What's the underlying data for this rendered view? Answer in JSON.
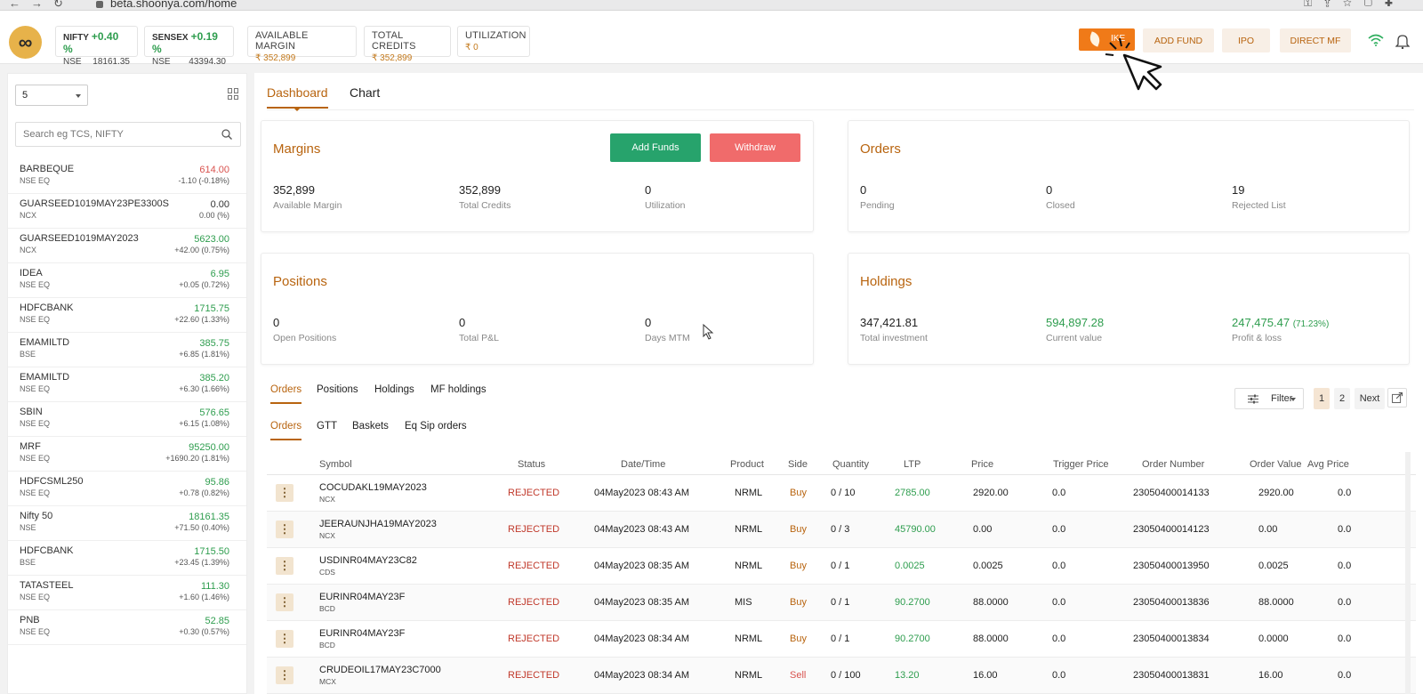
{
  "browser": {
    "url": "beta.shoonya.com/home"
  },
  "header": {
    "indices": [
      {
        "name": "NIFTY",
        "change": "+0.40 %",
        "exchange": "NSE",
        "value": "18161.35"
      },
      {
        "name": "SENSEX",
        "change": "+0.19 %",
        "exchange": "NSE",
        "value": "43394.30"
      }
    ],
    "stats": [
      {
        "label": "AVAILABLE MARGIN",
        "value": "₹ 352,899"
      },
      {
        "label": "TOTAL CREDITS",
        "value": "₹ 352,899"
      },
      {
        "label": "UTILIZATION",
        "value": "₹ 0"
      }
    ],
    "buttons": {
      "ike": "IKE",
      "add_fund": "ADD FUND",
      "ipo": "IPO",
      "direct_mf": "DIRECT MF"
    },
    "logo_glyph": "∞"
  },
  "watchlist": {
    "selected": "5",
    "search_placeholder": "Search eg TCS, NIFTY",
    "items": [
      {
        "symbol": "BARBEQUE",
        "exchange": "NSE EQ",
        "ltp": "614.00",
        "change": "-1.10 (-0.18%)",
        "dir": "down"
      },
      {
        "symbol": "GUARSEED1019MAY23PE3300S",
        "exchange": "NCX",
        "ltp": "0.00",
        "change": "0.00 (%)",
        "dir": "flat"
      },
      {
        "symbol": "GUARSEED1019MAY2023",
        "exchange": "NCX",
        "ltp": "5623.00",
        "change": "+42.00 (0.75%)",
        "dir": "up"
      },
      {
        "symbol": "IDEA",
        "exchange": "NSE EQ",
        "ltp": "6.95",
        "change": "+0.05 (0.72%)",
        "dir": "up"
      },
      {
        "symbol": "HDFCBANK",
        "exchange": "NSE EQ",
        "ltp": "1715.75",
        "change": "+22.60 (1.33%)",
        "dir": "up"
      },
      {
        "symbol": "EMAMILTD",
        "exchange": "BSE",
        "ltp": "385.75",
        "change": "+6.85 (1.81%)",
        "dir": "up"
      },
      {
        "symbol": "EMAMILTD",
        "exchange": "NSE EQ",
        "ltp": "385.20",
        "change": "+6.30 (1.66%)",
        "dir": "up"
      },
      {
        "symbol": "SBIN",
        "exchange": "NSE EQ",
        "ltp": "576.65",
        "change": "+6.15 (1.08%)",
        "dir": "up"
      },
      {
        "symbol": "MRF",
        "exchange": "NSE EQ",
        "ltp": "95250.00",
        "change": "+1690.20 (1.81%)",
        "dir": "up"
      },
      {
        "symbol": "HDFCSML250",
        "exchange": "NSE EQ",
        "ltp": "95.86",
        "change": "+0.78 (0.82%)",
        "dir": "up"
      },
      {
        "symbol": "Nifty 50",
        "exchange": "NSE",
        "ltp": "18161.35",
        "change": "+71.50 (0.40%)",
        "dir": "up"
      },
      {
        "symbol": "HDFCBANK",
        "exchange": "BSE",
        "ltp": "1715.50",
        "change": "+23.45 (1.39%)",
        "dir": "up"
      },
      {
        "symbol": "TATASTEEL",
        "exchange": "NSE EQ",
        "ltp": "111.30",
        "change": "+1.60 (1.46%)",
        "dir": "up"
      },
      {
        "symbol": "PNB",
        "exchange": "NSE EQ",
        "ltp": "52.85",
        "change": "+0.30 (0.57%)",
        "dir": "up"
      }
    ]
  },
  "main": {
    "tabs": [
      "Dashboard",
      "Chart"
    ],
    "margins": {
      "title": "Margins",
      "add_funds": "Add Funds",
      "withdraw": "Withdraw",
      "metrics": [
        {
          "value": "352,899",
          "label": "Available Margin"
        },
        {
          "value": "352,899",
          "label": "Total Credits"
        },
        {
          "value": "0",
          "label": "Utilization"
        }
      ]
    },
    "orders": {
      "title": "Orders",
      "metrics": [
        {
          "value": "0",
          "label": "Pending"
        },
        {
          "value": "0",
          "label": "Closed"
        },
        {
          "value": "19",
          "label": "Rejected List"
        }
      ]
    },
    "positions": {
      "title": "Positions",
      "metrics": [
        {
          "value": "0",
          "label": "Open Positions"
        },
        {
          "value": "0",
          "label": "Total P&L"
        },
        {
          "value": "0",
          "label": "Days MTM"
        }
      ]
    },
    "holdings": {
      "title": "Holdings",
      "metrics": [
        {
          "value": "347,421.81",
          "label": "Total investment"
        },
        {
          "value": "594,897.28",
          "label": "Current value"
        },
        {
          "value": "247,475.47",
          "pct": "(71.23%)",
          "label": "Profit & loss"
        }
      ]
    },
    "bottom_tabs": [
      "Orders",
      "Positions",
      "Holdings",
      "MF holdings"
    ],
    "order_tabs": [
      "Orders",
      "GTT",
      "Baskets",
      "Eq Sip orders"
    ],
    "filter_label": "Filter",
    "pagination": [
      "1",
      "2",
      "Next"
    ],
    "table": {
      "columns": [
        "Symbol",
        "Status",
        "Date/Time",
        "Product",
        "Side",
        "Quantity",
        "LTP",
        "Price",
        "Trigger Price",
        "Order Number",
        "Order Value",
        "Avg Price"
      ],
      "rows": [
        {
          "symbol": "COCUDAKL19MAY2023",
          "exch": "NCX",
          "status": "REJECTED",
          "datetime": "04May2023 08:43 AM",
          "product": "NRML",
          "side": "Buy",
          "qty": "0 / 10",
          "ltp": "2785.00",
          "price": "2920.00",
          "trigger": "0.0",
          "order_no": "23050400014133",
          "order_value": "2920.00",
          "avg": "0.0"
        },
        {
          "symbol": "JEERAUNJHA19MAY2023",
          "exch": "NCX",
          "status": "REJECTED",
          "datetime": "04May2023 08:43 AM",
          "product": "NRML",
          "side": "Buy",
          "qty": "0 / 3",
          "ltp": "45790.00",
          "price": "0.00",
          "trigger": "0.0",
          "order_no": "23050400014123",
          "order_value": "0.00",
          "avg": "0.0"
        },
        {
          "symbol": "USDINR04MAY23C82",
          "exch": "CDS",
          "status": "REJECTED",
          "datetime": "04May2023 08:35 AM",
          "product": "NRML",
          "side": "Buy",
          "qty": "0 / 1",
          "ltp": "0.0025",
          "price": "0.0025",
          "trigger": "0.0",
          "order_no": "23050400013950",
          "order_value": "0.0025",
          "avg": "0.0"
        },
        {
          "symbol": "EURINR04MAY23F",
          "exch": "BCD",
          "status": "REJECTED",
          "datetime": "04May2023 08:35 AM",
          "product": "MIS",
          "side": "Buy",
          "qty": "0 / 1",
          "ltp": "90.2700",
          "price": "88.0000",
          "trigger": "0.0",
          "order_no": "23050400013836",
          "order_value": "88.0000",
          "avg": "0.0"
        },
        {
          "symbol": "EURINR04MAY23F",
          "exch": "BCD",
          "status": "REJECTED",
          "datetime": "04May2023 08:34 AM",
          "product": "NRML",
          "side": "Buy",
          "qty": "0 / 1",
          "ltp": "90.2700",
          "price": "88.0000",
          "trigger": "0.0",
          "order_no": "23050400013834",
          "order_value": "0.0000",
          "avg": "0.0"
        },
        {
          "symbol": "CRUDEOIL17MAY23C7000",
          "exch": "MCX",
          "status": "REJECTED",
          "datetime": "04May2023 08:34 AM",
          "product": "NRML",
          "side": "Sell",
          "qty": "0 / 100",
          "ltp": "13.20",
          "price": "16.00",
          "trigger": "0.0",
          "order_no": "23050400013831",
          "order_value": "16.00",
          "avg": "0.0"
        }
      ]
    }
  }
}
